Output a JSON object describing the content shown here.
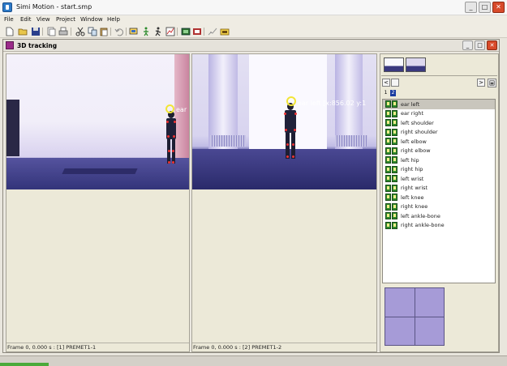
{
  "app": {
    "title": "Simi Motion - start.smp",
    "window_buttons": {
      "minimize": "_",
      "maximize": "□",
      "close": "✕"
    }
  },
  "menu": [
    "File",
    "Edit",
    "View",
    "Project",
    "Window",
    "Help"
  ],
  "toolbar_icons": [
    "new-icon",
    "open-icon",
    "save-icon",
    "copy-doc-icon",
    "print-icon",
    "cut-icon",
    "copy-icon",
    "paste-icon",
    "undo-icon",
    "camera-view-icon",
    "walk-figure-icon",
    "run-figure-icon",
    "chart-icon",
    "video-icon",
    "film-icon",
    "analysis-icon",
    "folder-icon"
  ],
  "child_window": {
    "title": "3D tracking",
    "buttons": {
      "minimize": "_",
      "maximize": "□",
      "close": "✕"
    }
  },
  "view1": {
    "label": "ear",
    "status": "Frame 0, 0.000 s : [1] PREMET1-1"
  },
  "view2": {
    "label": "ear left [x:856.02 y:1",
    "status": "Frame 0, 0.000 s : [2] PREMET1-2"
  },
  "panel": {
    "nav_prev": "<",
    "nav_next": ">",
    "pages": [
      "1",
      "2"
    ],
    "selected_point": "ear left",
    "points": [
      "ear left",
      "ear right",
      "left shoulder",
      "right shoulder",
      "left elbow",
      "right elbow",
      "left hip",
      "right hip",
      "left wrist",
      "right wrist",
      "left knee",
      "right knee",
      "left ankle-bone",
      "right ankle-bone"
    ]
  },
  "colors": {
    "marker": "#f2e536",
    "joint": "#e33333",
    "selection": "#c9c6bd",
    "grid_fill": "#a69bd7"
  }
}
